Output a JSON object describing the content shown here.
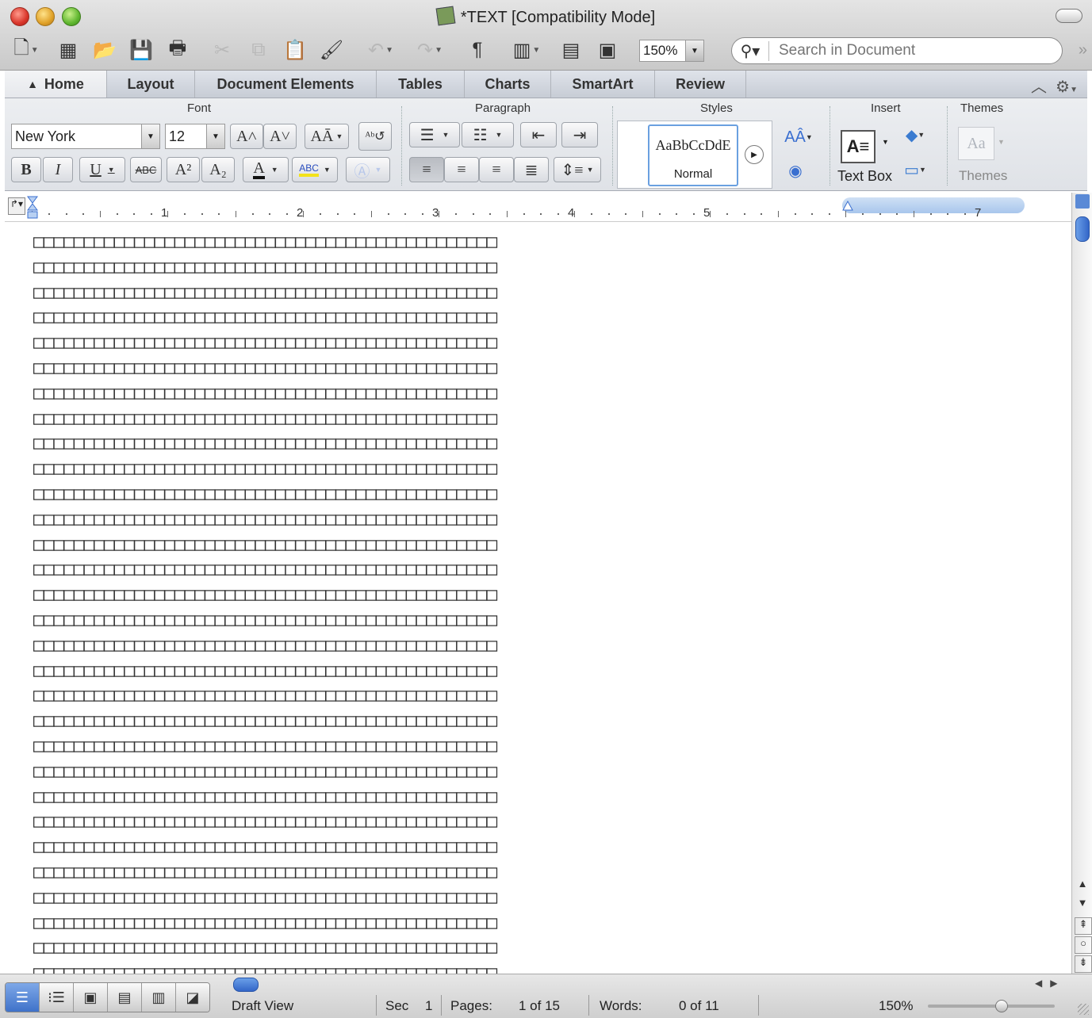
{
  "window": {
    "title": "*TEXT [Compatibility Mode]"
  },
  "toolbar": {
    "zoom_value": "150%",
    "search_placeholder": "Search in Document",
    "icons": [
      "new-document-icon",
      "templates-icon",
      "open-icon",
      "save-icon",
      "print-icon",
      "cut-icon",
      "copy-icon",
      "paste-icon",
      "format-painter-icon",
      "undo-icon",
      "redo-icon",
      "pilcrow-icon",
      "sidebar-icon",
      "gallery-icon",
      "toolbox-icon"
    ]
  },
  "tabs": [
    {
      "label": "Home",
      "active": true
    },
    {
      "label": "Layout"
    },
    {
      "label": "Document Elements"
    },
    {
      "label": "Tables"
    },
    {
      "label": "Charts"
    },
    {
      "label": "SmartArt"
    },
    {
      "label": "Review"
    }
  ],
  "ribbon": {
    "groups": {
      "font": "Font",
      "paragraph": "Paragraph",
      "styles": "Styles",
      "insert": "Insert",
      "themes": "Themes"
    },
    "font_name": "New York",
    "font_size": "12",
    "grow_font": "A˄",
    "shrink_font": "A˅",
    "change_case": "AĀ",
    "bold": "B",
    "italic": "I",
    "underline": "U",
    "strikethrough": "ABC",
    "superscript": "A²",
    "subscript": "A₂",
    "font_color": "A",
    "highlight": "ABC",
    "style_sample": "AaBbCcDdE",
    "style_name": "Normal",
    "text_box_label": "Text Box",
    "themes_label": "Themes",
    "themes_sample": "Aa"
  },
  "ruler": {
    "numbers": [
      "1",
      "2",
      "3",
      "4",
      "5",
      "7"
    ]
  },
  "document": {
    "glyph": "□",
    "columns": 46,
    "rows": 30
  },
  "statusbar": {
    "view_label": "Draft View",
    "sec_label": "Sec",
    "sec_value": "1",
    "pages_label": "Pages:",
    "pages_value": "1 of 15",
    "words_label": "Words:",
    "words_value": "0 of 11",
    "zoom_value": "150%"
  }
}
